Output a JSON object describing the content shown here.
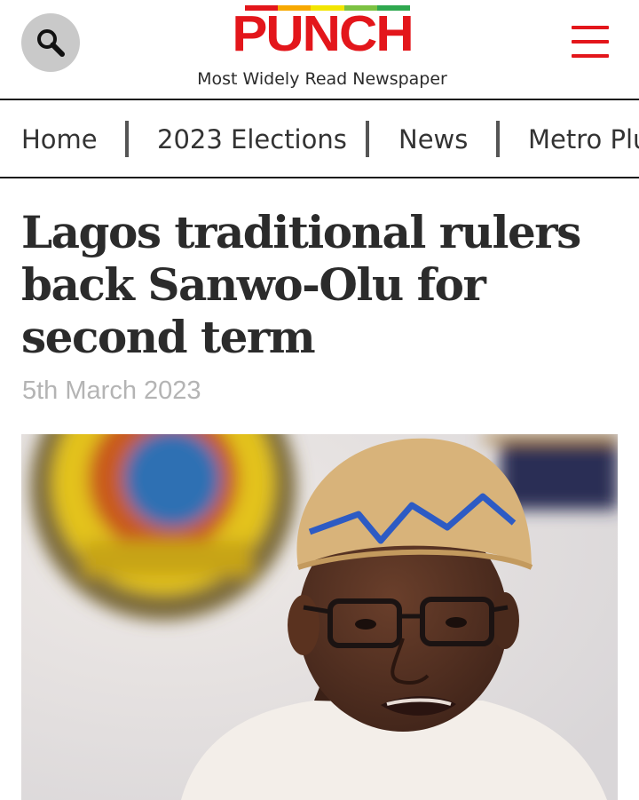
{
  "header": {
    "search_icon": "search-icon",
    "logo_text": "PUNCH",
    "logo_bar_colors": [
      "#e3161b",
      "#f7a800",
      "#f2e500",
      "#7cc242",
      "#2fa84f"
    ],
    "tagline": "Most Widely Read Newspaper",
    "menu_icon": "hamburger-menu-icon",
    "accent_color": "#e3161b"
  },
  "nav": {
    "items": [
      {
        "label": "Home"
      },
      {
        "label": "2023 Elections"
      },
      {
        "label": "News"
      },
      {
        "label": "Metro Plus"
      }
    ]
  },
  "article": {
    "title": "Lagos traditional rulers back Sanwo-Olu for second term",
    "date": "5th March 2023"
  }
}
